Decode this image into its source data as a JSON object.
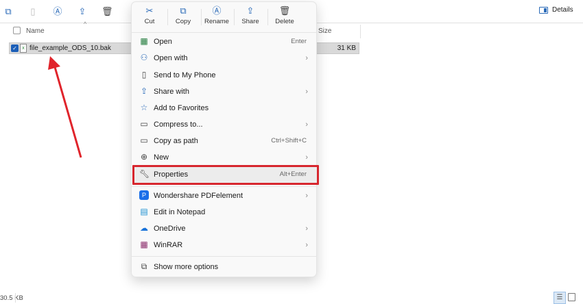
{
  "toolbar": {
    "details_label": "Details"
  },
  "columns": {
    "name": "Name",
    "size": "Size"
  },
  "file": {
    "name": "file_example_ODS_10.bak",
    "size": "31 KB"
  },
  "quick_actions": [
    {
      "label": "Cut",
      "icon": "scissors-icon"
    },
    {
      "label": "Copy",
      "icon": "copy-icon"
    },
    {
      "label": "Rename",
      "icon": "rename-icon"
    },
    {
      "label": "Share",
      "icon": "share-icon"
    },
    {
      "label": "Delete",
      "icon": "trash-icon"
    }
  ],
  "menu_items": [
    {
      "label": "Open",
      "shortcut": "Enter"
    },
    {
      "label": "Open with",
      "submenu": true
    },
    {
      "label": "Send to My Phone"
    },
    {
      "label": "Share with",
      "submenu": true
    },
    {
      "label": "Add to Favorites"
    },
    {
      "label": "Compress to...",
      "submenu": true
    },
    {
      "label": "Copy as path",
      "shortcut": "Ctrl+Shift+C"
    },
    {
      "label": "New",
      "submenu": true
    },
    {
      "label": "Properties",
      "shortcut": "Alt+Enter",
      "highlighted": true
    },
    {
      "label": "Wondershare PDFelement",
      "submenu": true
    },
    {
      "label": "Edit in Notepad"
    },
    {
      "label": "OneDrive",
      "submenu": true
    },
    {
      "label": "WinRAR",
      "submenu": true
    },
    {
      "label": "Show more options"
    }
  ],
  "status": {
    "size": "30.5 KB"
  },
  "colors": {
    "accent": "#2a6ab8",
    "highlight_border": "#d7262e",
    "arrow": "#e0242b"
  }
}
